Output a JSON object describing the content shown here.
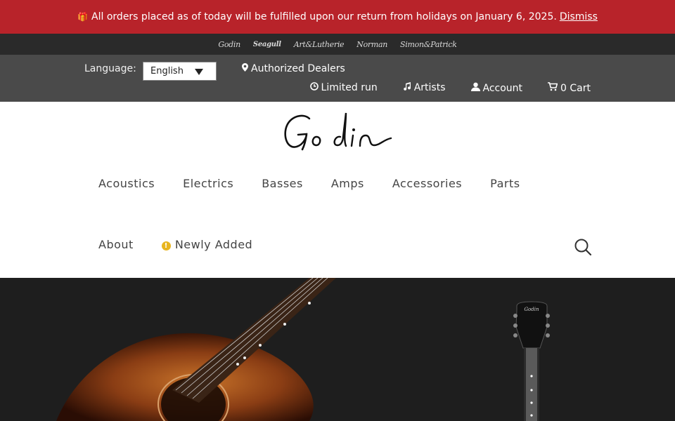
{
  "announcement": {
    "text": "All orders placed as of today will be fulfilled upon our return from holidays on January 6, 2025.",
    "dismiss": "Dismiss",
    "icon": "gift-icon"
  },
  "brands": [
    {
      "label": "Godin"
    },
    {
      "label": "Seagull"
    },
    {
      "label": "Art&Lutherie"
    },
    {
      "label": "Norman"
    },
    {
      "label": "Simon&Patrick"
    }
  ],
  "utility": {
    "language_label": "Language:",
    "language_value": "English",
    "dealers": "Authorized Dealers",
    "limited_run": "Limited run",
    "artists": "Artists",
    "account": "Account",
    "cart": "0 Cart"
  },
  "logo_text": "Godin",
  "nav_primary": [
    "Acoustics",
    "Electrics",
    "Basses",
    "Amps",
    "Accessories",
    "Parts"
  ],
  "nav_secondary": {
    "about": "About",
    "newly_added": "Newly Added"
  },
  "colors": {
    "announcement_bg": "#b8232a",
    "brandbar_bg": "#2a2a2a",
    "utility_bg": "#4a4a4a",
    "hero_bg": "#1e1e1e",
    "new_badge": "#e8b51f"
  }
}
